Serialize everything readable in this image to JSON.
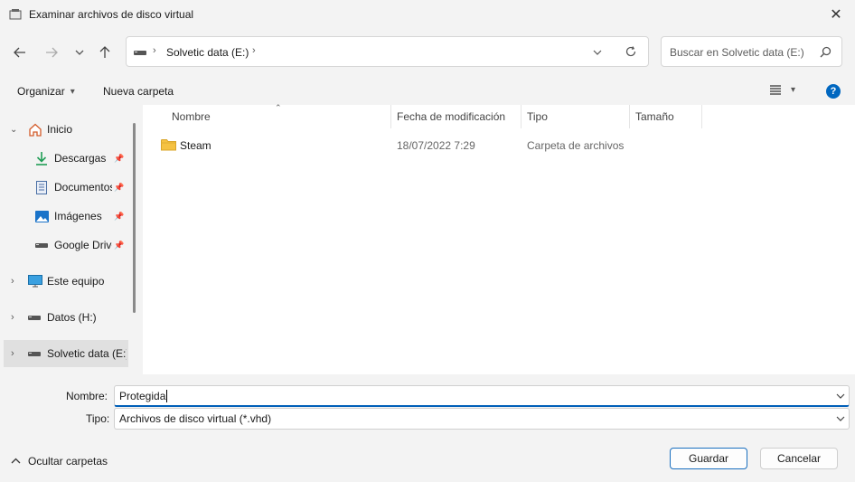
{
  "window": {
    "title": "Examinar archivos de disco virtual"
  },
  "nav": {
    "breadcrumb": [
      "Solvetic data (E:)"
    ],
    "search_placeholder": "Buscar en Solvetic data (E:)"
  },
  "toolbar": {
    "organize_label": "Organizar",
    "new_folder_label": "Nueva carpeta"
  },
  "sidebar": {
    "items": [
      {
        "label": "Inicio"
      },
      {
        "label": "Descargas"
      },
      {
        "label": "Documentos"
      },
      {
        "label": "Imágenes"
      },
      {
        "label": "Google Drive"
      },
      {
        "label": "Este equipo"
      },
      {
        "label": "Datos (H:)"
      },
      {
        "label": "Solvetic data (E:)"
      }
    ]
  },
  "columns": {
    "name": "Nombre",
    "modified": "Fecha de modificación",
    "type": "Tipo",
    "size": "Tamaño"
  },
  "files": [
    {
      "name": "Steam",
      "modified": "18/07/2022 7:29",
      "type": "Carpeta de archivos",
      "size": ""
    }
  ],
  "form": {
    "name_label": "Nombre:",
    "name_value": "Protegida",
    "type_label": "Tipo:",
    "type_value": "Archivos de disco virtual (*.vhd)"
  },
  "footer": {
    "hide_folders_label": "Ocultar carpetas",
    "save_label": "Guardar",
    "cancel_label": "Cancelar"
  },
  "colors": {
    "accent": "#005fb8",
    "help": "#0067c0",
    "folder": "#f5c242"
  }
}
